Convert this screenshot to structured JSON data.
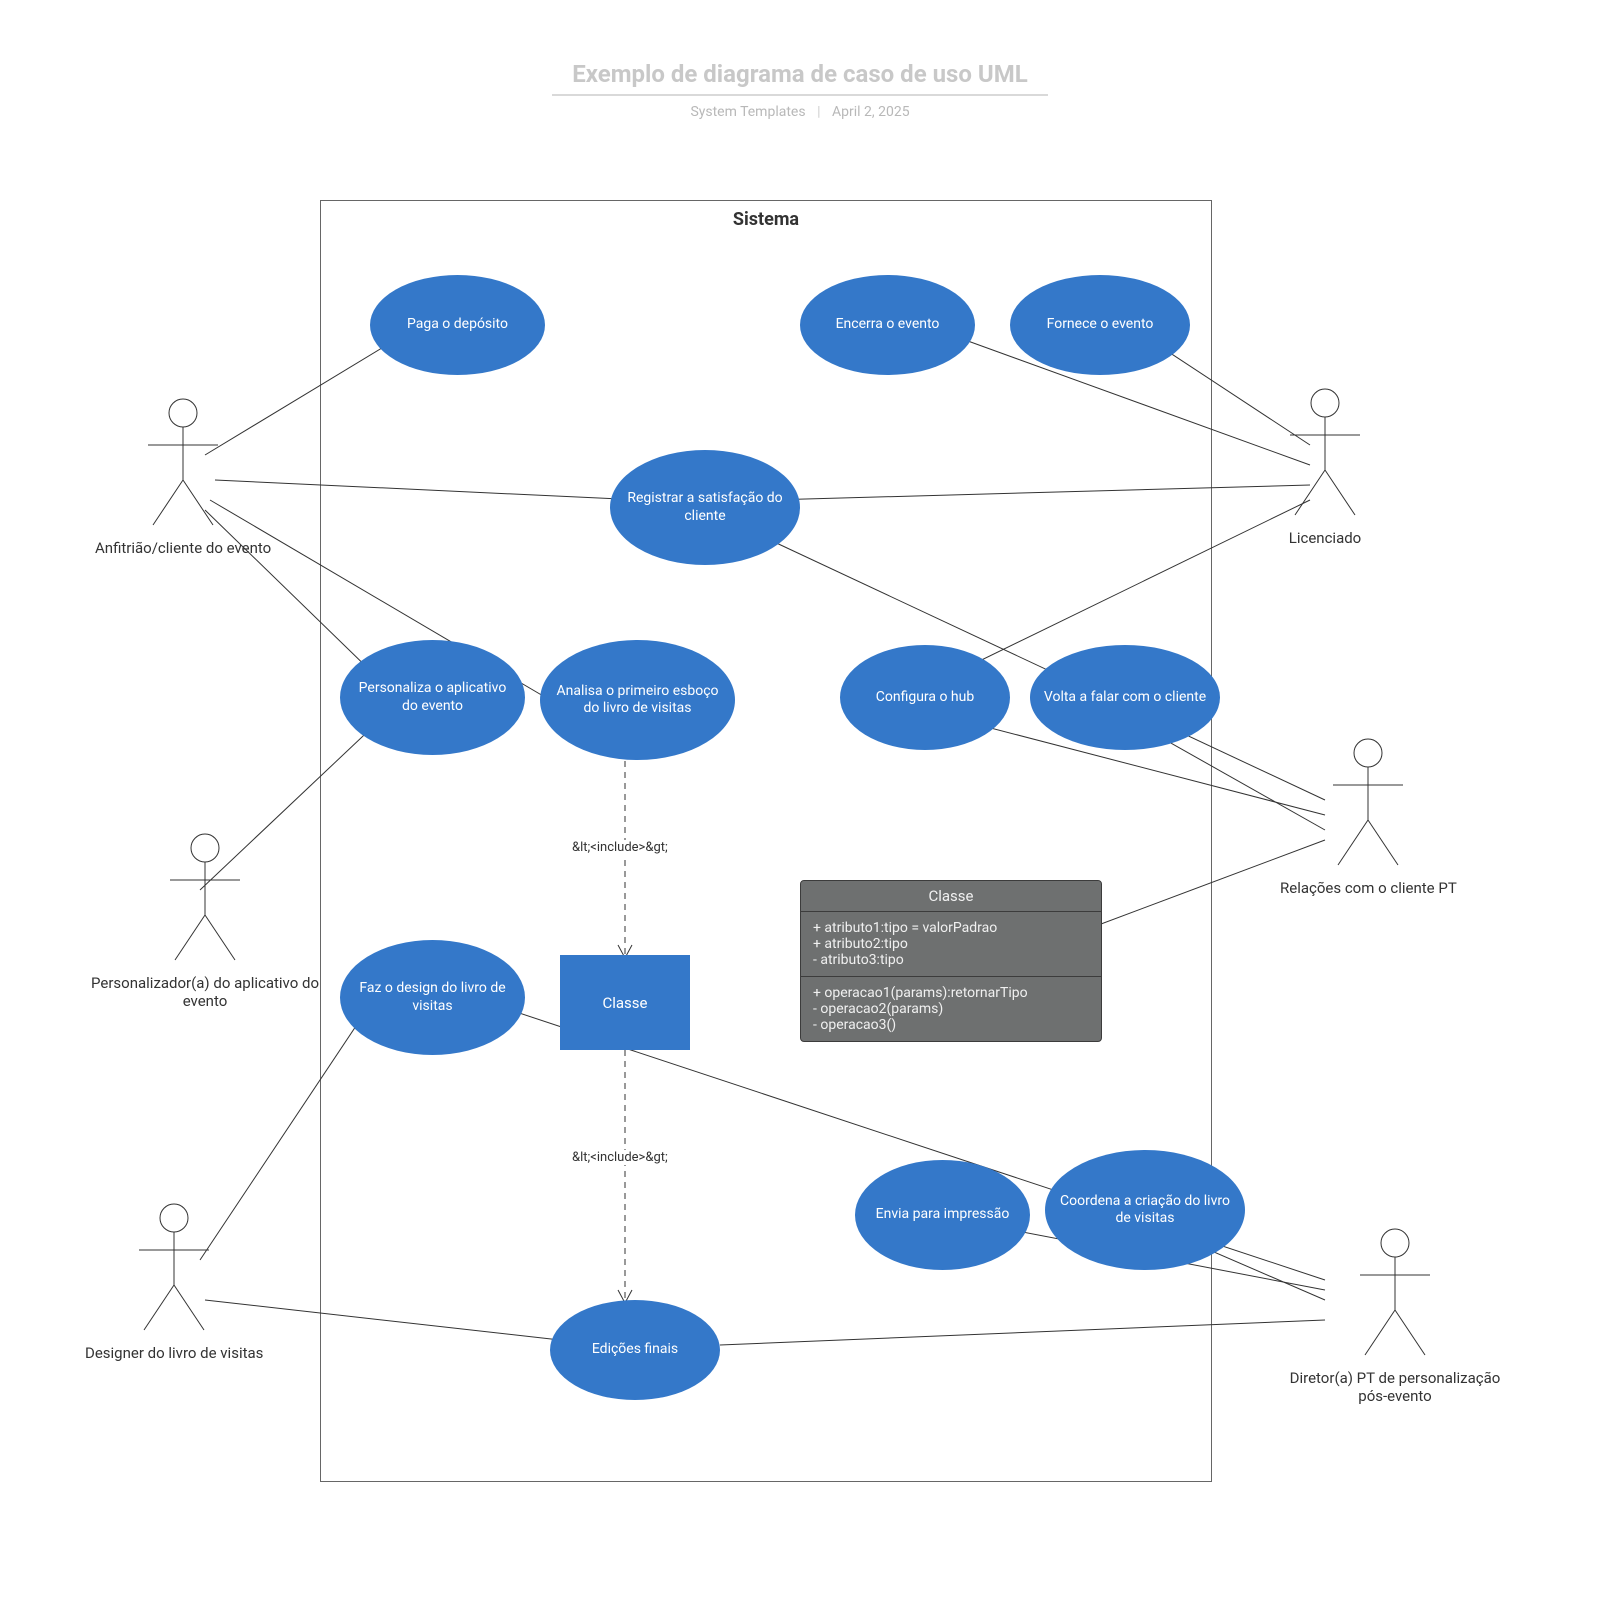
{
  "title": "Exemplo de diagrama de caso de uso UML",
  "subtitle_author": "System Templates",
  "subtitle_date": "April 2, 2025",
  "system_label": "Sistema",
  "include_label": "&lt;<include>&gt;",
  "actors": {
    "host": {
      "label": "Anfitrião/cliente do evento"
    },
    "customizer": {
      "label": "Personalizador(a) do aplicativo do evento"
    },
    "gb_designer": {
      "label": "Designer do livro de visitas"
    },
    "licensee": {
      "label": "Licenciado"
    },
    "cr_pt": {
      "label": "Relações com o cliente PT"
    },
    "pt_dir": {
      "label": "Diretor(a) PT de personalização pós-evento"
    }
  },
  "usecases": {
    "deposit": "Paga o depósito",
    "close_event": "Encerra o evento",
    "provide_event": "Fornece o evento",
    "reg_sat": "Registrar a satisfação do cliente",
    "pers_app": "Personaliza o aplicativo do evento",
    "review_gb": "Analisa o primeiro esboço do livro de visitas",
    "config_hub": "Configura o hub",
    "follow_up": "Volta a falar com o cliente",
    "design_gb": "Faz o design do livro de visitas",
    "send_print": "Envia para impressão",
    "coord_gb": "Coordena a criação do livro de visitas",
    "final_edits": "Edições finais"
  },
  "class_block": "Classe",
  "classbox": {
    "name": "Classe",
    "attrs": [
      "+ atributo1:tipo = valorPadrao",
      "+ atributo2:tipo",
      "- atributo3:tipo"
    ],
    "ops": [
      "+ operacao1(params):retornarTipo",
      "- operacao2(params)",
      "- operacao3()"
    ]
  }
}
